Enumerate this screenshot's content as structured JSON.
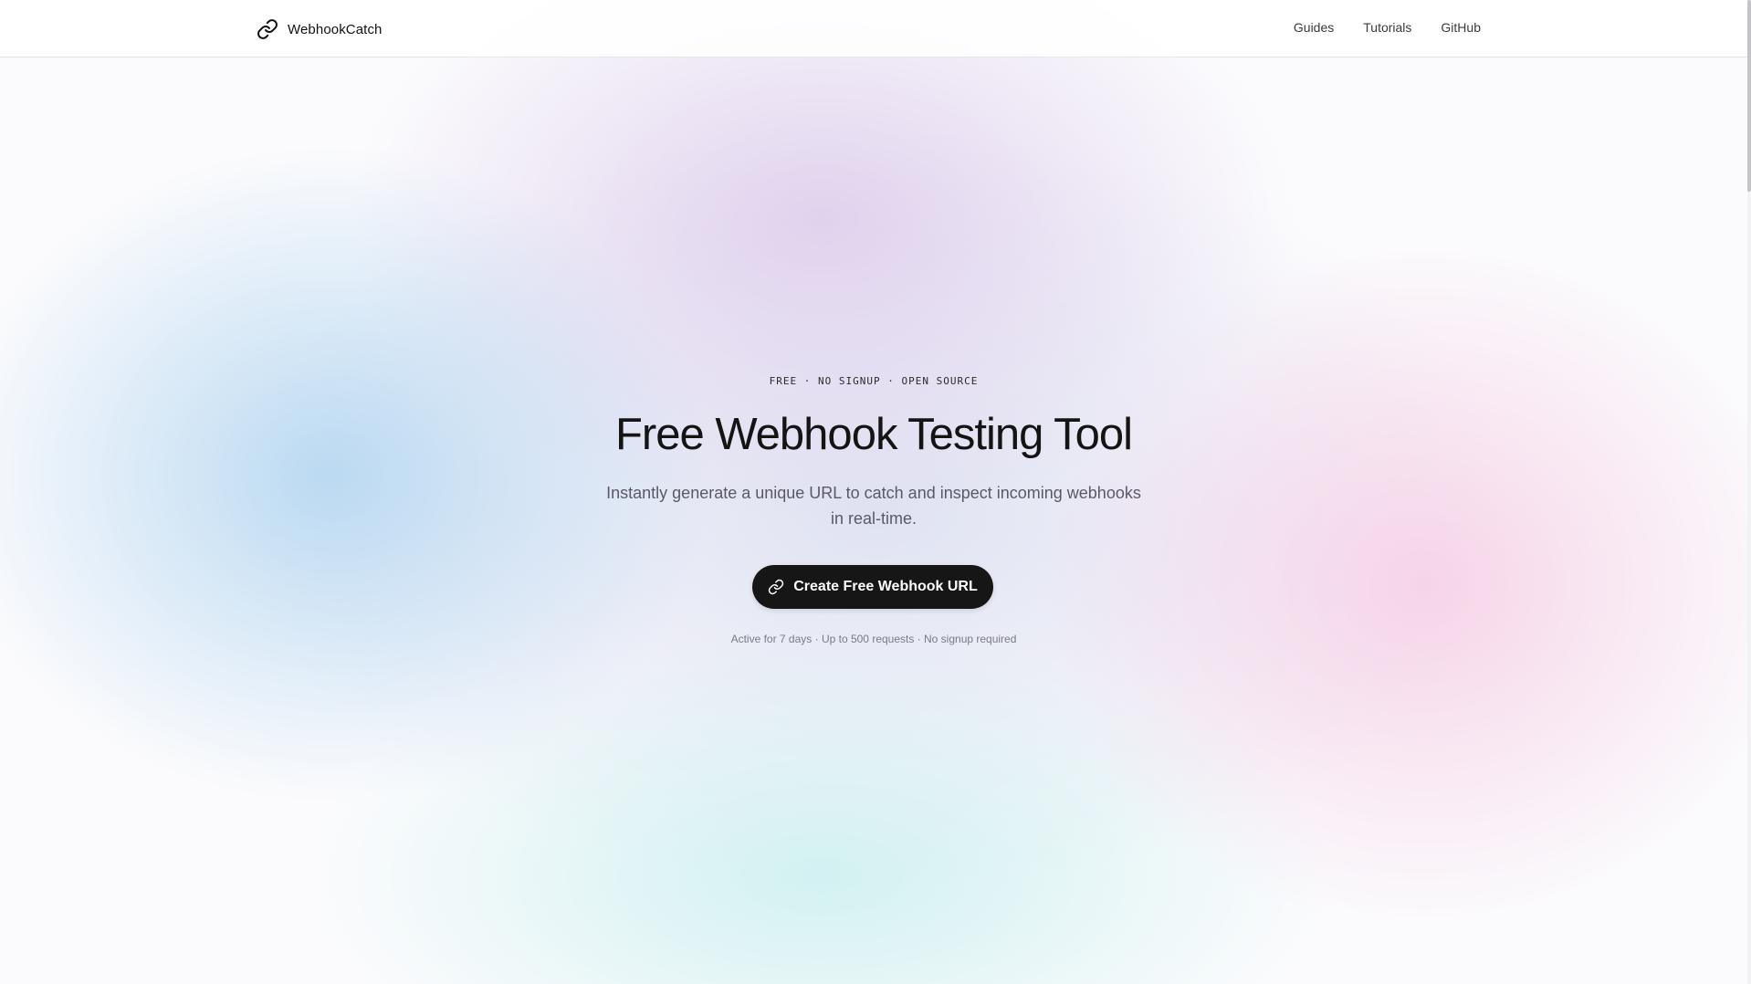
{
  "header": {
    "brand": "WebhookCatch",
    "brand_icon": "link-icon",
    "nav": [
      {
        "label": "Guides"
      },
      {
        "label": "Tutorials"
      },
      {
        "label": "GitHub"
      }
    ]
  },
  "hero": {
    "eyebrow": "FREE · NO SIGNUP · OPEN SOURCE",
    "title": "Free Webhook Testing Tool",
    "subtitle": "Instantly generate a unique URL to catch and inspect incoming webhooks in real-time.",
    "cta_label": "Create Free Webhook URL",
    "cta_icon": "link-icon",
    "note": "Active for 7 days · Up to 500 requests · No signup required"
  },
  "colors": {
    "button_bg": "#161616",
    "button_text": "#ffffff",
    "title": "#141414",
    "subtitle": "#5a5a66"
  }
}
